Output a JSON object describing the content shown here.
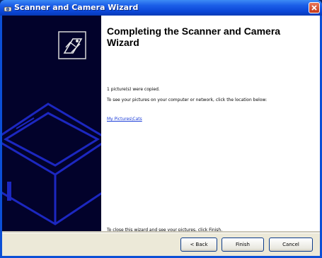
{
  "window": {
    "title": "Scanner and Camera Wizard"
  },
  "content": {
    "heading": "Completing the Scanner and Camera Wizard",
    "copied_text": "1 picture(s) were copied.",
    "see_pictures_text": "To see your pictures on your computer or network, click the location below:",
    "location_link": "My Pictures\\Cats",
    "close_instruction": "To close this wizard and see your pictures, click Finish."
  },
  "buttons": {
    "back": "< Back",
    "finish": "Finish",
    "cancel": "Cancel"
  },
  "icons": {
    "title_icon": "scanner-camera-icon",
    "close": "close-icon",
    "wizard_icon": "camera-wizard-icon",
    "illustration": "scanner-illustration"
  },
  "colors": {
    "titlebar": "#0a45d6",
    "side_panel": "#02022b",
    "link": "#1a3cd8",
    "button_bar": "#ece9d8"
  }
}
